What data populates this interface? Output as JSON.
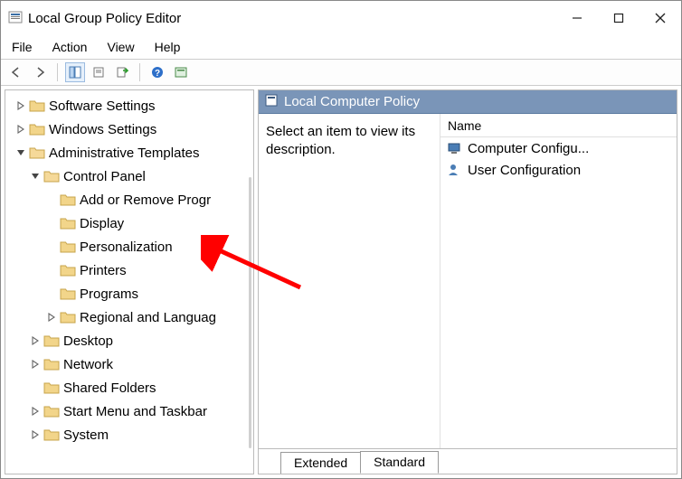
{
  "window": {
    "title": "Local Group Policy Editor"
  },
  "menu": {
    "file": "File",
    "action": "Action",
    "view": "View",
    "help": "Help"
  },
  "tree": {
    "items": [
      {
        "indent": 1,
        "expander": ">",
        "label": "Software Settings"
      },
      {
        "indent": 1,
        "expander": ">",
        "label": "Windows Settings"
      },
      {
        "indent": 1,
        "expander": "v",
        "label": "Administrative Templates"
      },
      {
        "indent": 2,
        "expander": "v",
        "label": "Control Panel"
      },
      {
        "indent": 3,
        "expander": "",
        "label": "Add or Remove Progr"
      },
      {
        "indent": 3,
        "expander": "",
        "label": "Display"
      },
      {
        "indent": 3,
        "expander": "",
        "label": "Personalization"
      },
      {
        "indent": 3,
        "expander": "",
        "label": "Printers"
      },
      {
        "indent": 3,
        "expander": "",
        "label": "Programs"
      },
      {
        "indent": 3,
        "expander": ">",
        "label": "Regional and Languag"
      },
      {
        "indent": 2,
        "expander": ">",
        "label": "Desktop"
      },
      {
        "indent": 2,
        "expander": ">",
        "label": "Network"
      },
      {
        "indent": 2,
        "expander": "",
        "label": "Shared Folders"
      },
      {
        "indent": 2,
        "expander": ">",
        "label": "Start Menu and Taskbar"
      },
      {
        "indent": 2,
        "expander": ">",
        "label": "System"
      }
    ]
  },
  "right": {
    "header": "Local Computer Policy",
    "description": "Select an item to view its description.",
    "column_header": "Name",
    "items": [
      {
        "label": "Computer Configu..."
      },
      {
        "label": "User Configuration"
      }
    ]
  },
  "tabs": {
    "extended": "Extended",
    "standard": "Standard"
  }
}
